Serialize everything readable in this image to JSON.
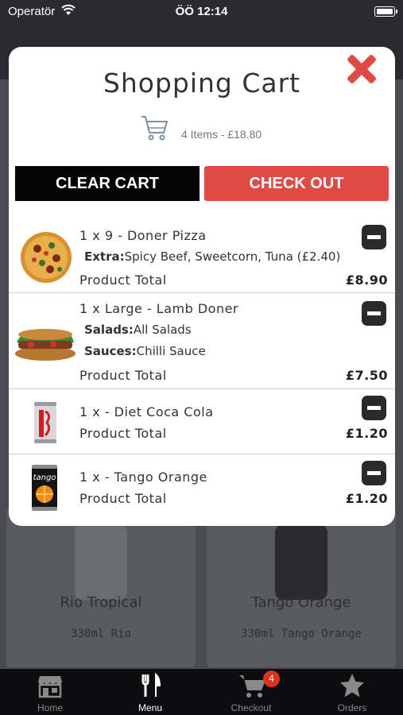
{
  "status_bar": {
    "carrier": "Operatör",
    "time": "ÖÖ 12:14"
  },
  "background": {
    "cards": [
      {
        "title": "Rio Tropical",
        "subtitle": "330ml Rio"
      },
      {
        "title": "Tango Orange",
        "subtitle": "330ml Tango Orange"
      }
    ]
  },
  "cart": {
    "title": "Shopping Cart",
    "summary": "4 Items - £18.80",
    "clear_label": "CLEAR CART",
    "checkout_label": "CHECK OUT",
    "product_total_label": "Product Total",
    "items": [
      {
        "name": "1 x 9 - Doner Pizza",
        "options": [
          {
            "label": "Extra:",
            "value": "Spicy Beef, Sweetcorn, Tuna (£2.40)"
          }
        ],
        "total": "£8.90",
        "image": "pizza"
      },
      {
        "name": "1 x Large - Lamb Doner",
        "options": [
          {
            "label": "Salads:",
            "value": "All Salads"
          },
          {
            "label": "Sauces:",
            "value": "Chilli Sauce"
          }
        ],
        "total": "£7.50",
        "image": "doner-kebab"
      },
      {
        "name": "1 x - Diet Coca Cola",
        "options": [],
        "total": "£1.20",
        "image": "diet-coke-can"
      },
      {
        "name": "1 x - Tango Orange",
        "options": [],
        "total": "£1.20",
        "image": "tango-orange-can"
      }
    ]
  },
  "tabbar": {
    "tabs": [
      {
        "label": "Home",
        "icon": "store-icon"
      },
      {
        "label": "Menu",
        "icon": "cutlery-icon"
      },
      {
        "label": "Checkout",
        "icon": "cart-icon"
      },
      {
        "label": "Orders",
        "icon": "star-icon"
      }
    ],
    "active": "Menu",
    "checkout_badge": "4"
  },
  "colors": {
    "accent": "#e04a45",
    "clear_button": "#050505",
    "tabbar": "#0d0d0f"
  }
}
